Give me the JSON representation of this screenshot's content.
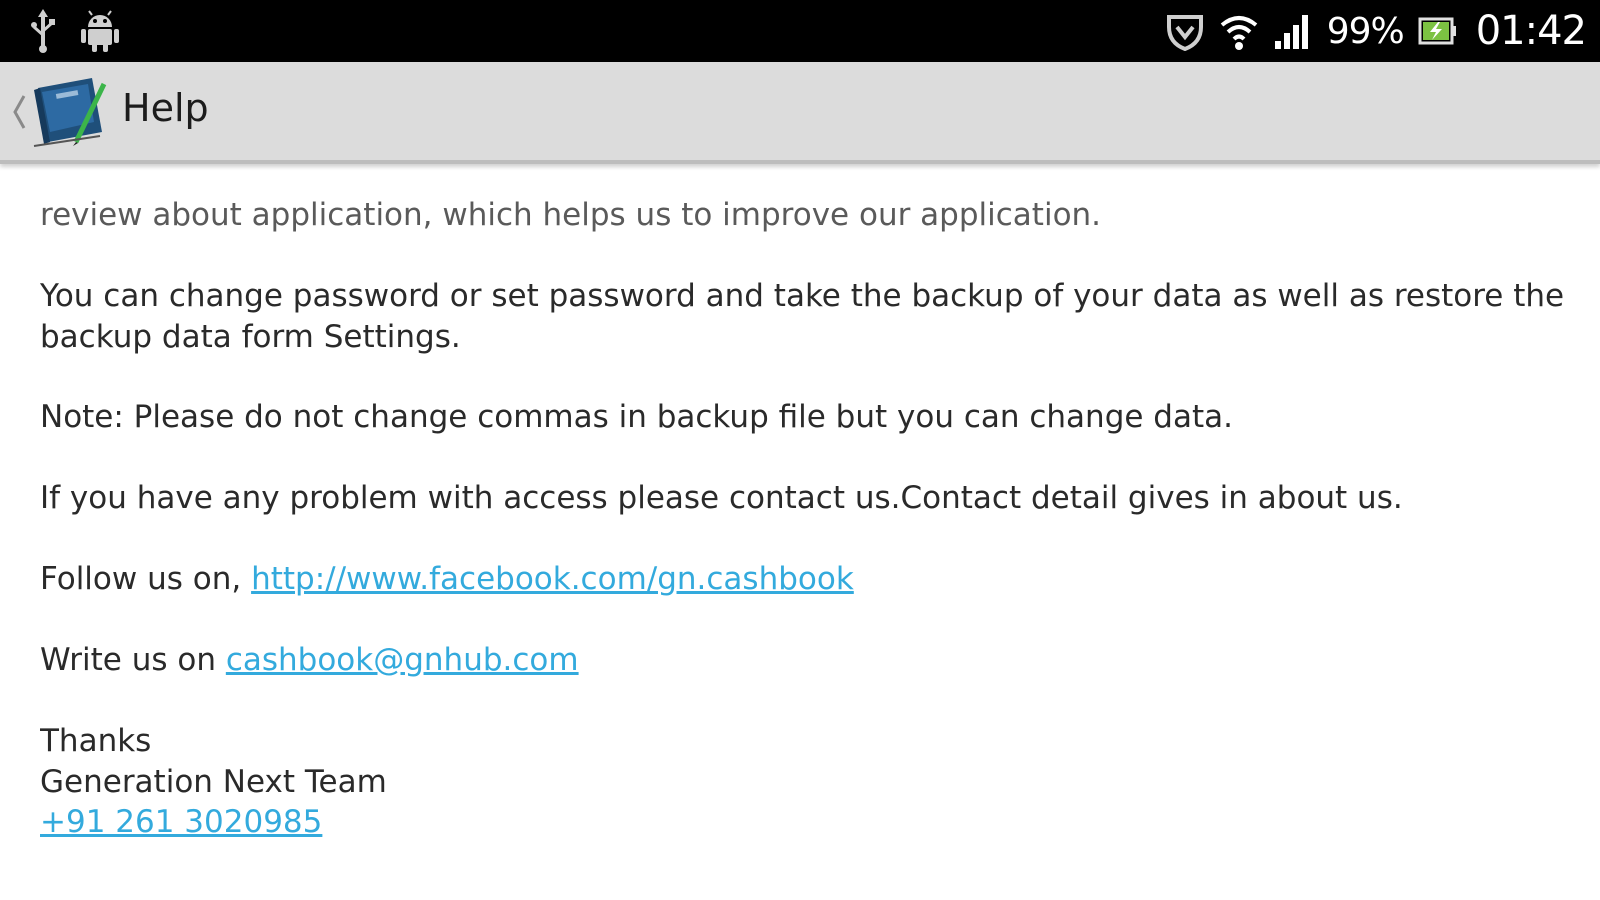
{
  "status_bar": {
    "left_icons": [
      "usb-icon",
      "android-debug-icon"
    ],
    "right_icons": [
      "shield-icon",
      "wifi-icon",
      "signal-icon",
      "battery-icon"
    ],
    "battery_percent": "99%",
    "time": "01:42"
  },
  "action_bar": {
    "title": "Help",
    "icons": [
      "back-caret-icon",
      "app-book-logo-icon"
    ]
  },
  "content": {
    "cut_line": "review about application, which helps us to improve our application.",
    "para_settings": "You can change password or set password and take the backup of your data as well as restore the backup data form Settings.",
    "para_note": "Note: Please do not change commas in backup file but you can change data.",
    "para_problem": "If you have any problem with access please contact us.Contact detail gives in about us.",
    "follow_prefix": "Follow us on, ",
    "facebook_link": "http://www.facebook.com/gn.cashbook",
    "write_prefix": "Write us on ",
    "email_link": "cashbook@gnhub.com",
    "thanks": "Thanks",
    "team": "Generation Next Team",
    "phone_link": "+91 261 3020985"
  },
  "colors": {
    "status_bar": "#000000",
    "action_bar": "#dcdcdc",
    "link": "#33aadd",
    "text": "#2a2a2a"
  }
}
